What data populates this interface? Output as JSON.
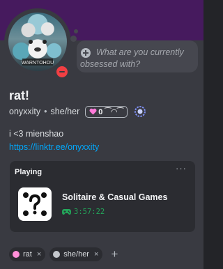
{
  "profile": {
    "display_name": "rat!",
    "username": "onyxxity",
    "separator": "•",
    "pronouns": "she/her",
    "nameplate_badge": "0 ⁀◠⁀",
    "bio": "i <3 mienshao",
    "link": "https://linktr.ee/onyxxity",
    "status": "dnd",
    "avatar_caption": "WARNTOHOU"
  },
  "status_bubble": {
    "placeholder": "What are you currently obsessed with?",
    "icon": "plus-circle-icon"
  },
  "activity": {
    "label": "Playing",
    "menu_glyph": "···",
    "game_title": "Solitaire & Casual Games",
    "elapsed": "3:57:22",
    "game_icon": "dice-five-icon"
  },
  "tags": [
    {
      "label": "rat",
      "color": "#ff8fd8",
      "remove": "×"
    },
    {
      "label": "she/her",
      "color": "#c4c7cc",
      "remove": "×"
    }
  ],
  "add_tag_glyph": "+",
  "colors": {
    "banner": "#461a5e",
    "card": "#393a41",
    "activity_bg": "#2b2c31",
    "link": "#00a8fc",
    "elapsed": "#23a55a",
    "dnd": "#f23f43"
  }
}
